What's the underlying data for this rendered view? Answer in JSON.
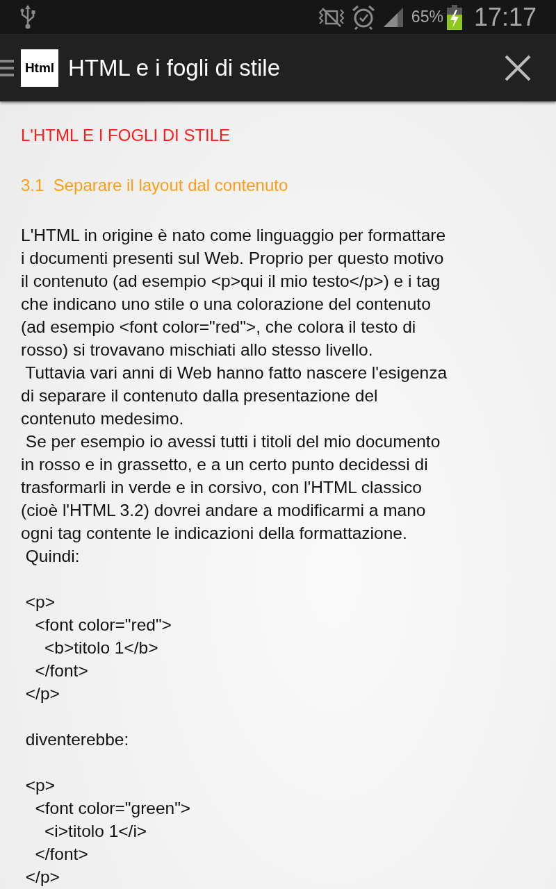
{
  "status_bar": {
    "battery": "65%",
    "time": "17:17"
  },
  "app_bar": {
    "logo": "Html",
    "title": "HTML e i fogli di stile"
  },
  "content": {
    "heading": "L'HTML E I FOGLI DI STILE",
    "subheading": "3.1  Separare il layout dal contenuto",
    "blocks": [
      {
        "kind": "paragraph",
        "lines": [
          "L'HTML in origine è nato come linguaggio per formattare",
          "i documenti presenti sul Web. Proprio per questo motivo",
          "il contenuto (ad esempio <p>qui il mio testo</p>) e i tag",
          "che indicano uno stile o una colorazione del contenuto",
          "(ad esempio <font color=\"red\">, che colora il testo di",
          "rosso) si trovavano mischiati allo stesso livello."
        ]
      },
      {
        "kind": "paragraph",
        "lines": [
          " Tuttavia vari anni di Web hanno fatto nascere l'esigenza",
          "di separare il contenuto dalla presentazione del",
          "contenuto medesimo."
        ]
      },
      {
        "kind": "paragraph",
        "lines": [
          " Se per esempio io avessi tutti i titoli del mio documento",
          "in rosso e in grassetto, e a un certo punto decidessi di",
          "trasformarli in verde e in corsivo, con l'HTML classico",
          "(cioè l'HTML 3.2) dovrei andare a modificarmi a mano",
          "ogni tag contente le indicazioni della formattazione."
        ]
      },
      {
        "kind": "paragraph",
        "lines": [
          " Quindi:"
        ]
      },
      {
        "kind": "gap"
      },
      {
        "kind": "code",
        "lines": [
          " <p>",
          "   <font color=\"red\">",
          "     <b>titolo 1</b>",
          "   </font>",
          " </p>"
        ]
      },
      {
        "kind": "gap"
      },
      {
        "kind": "paragraph",
        "lines": [
          " diventerebbe:"
        ]
      },
      {
        "kind": "gap"
      },
      {
        "kind": "code",
        "lines": [
          " <p>",
          "   <font color=\"green\">",
          "     <i>titolo 1</i>",
          "   </font>",
          " </p>"
        ]
      }
    ]
  }
}
